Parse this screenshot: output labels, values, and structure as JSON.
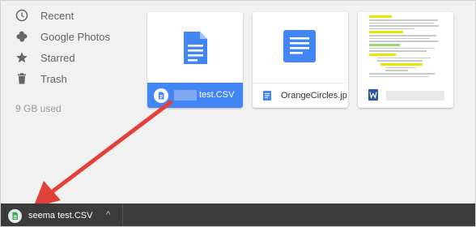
{
  "sidebar": {
    "items": [
      {
        "label": "Recent",
        "icon": "clock-icon"
      },
      {
        "label": "Google Photos",
        "icon": "pinwheel-icon"
      },
      {
        "label": "Starred",
        "icon": "star-icon"
      },
      {
        "label": "Trash",
        "icon": "trash-icon"
      }
    ],
    "storage_used": "9 GB used"
  },
  "files": [
    {
      "name": "test.CSV",
      "type": "doc",
      "selected": true
    },
    {
      "name": "OrangeCircles.jp...",
      "type": "doc",
      "selected": false
    },
    {
      "name": "",
      "type": "word-doc",
      "selected": false
    }
  ],
  "download_bar": {
    "file_name": "seema test.CSV",
    "chevron": "^"
  },
  "colors": {
    "accent_blue": "#4285f4",
    "arrow_red": "#e2413a",
    "download_bar": "#3b3b3b",
    "csv_green": "#34a853"
  }
}
